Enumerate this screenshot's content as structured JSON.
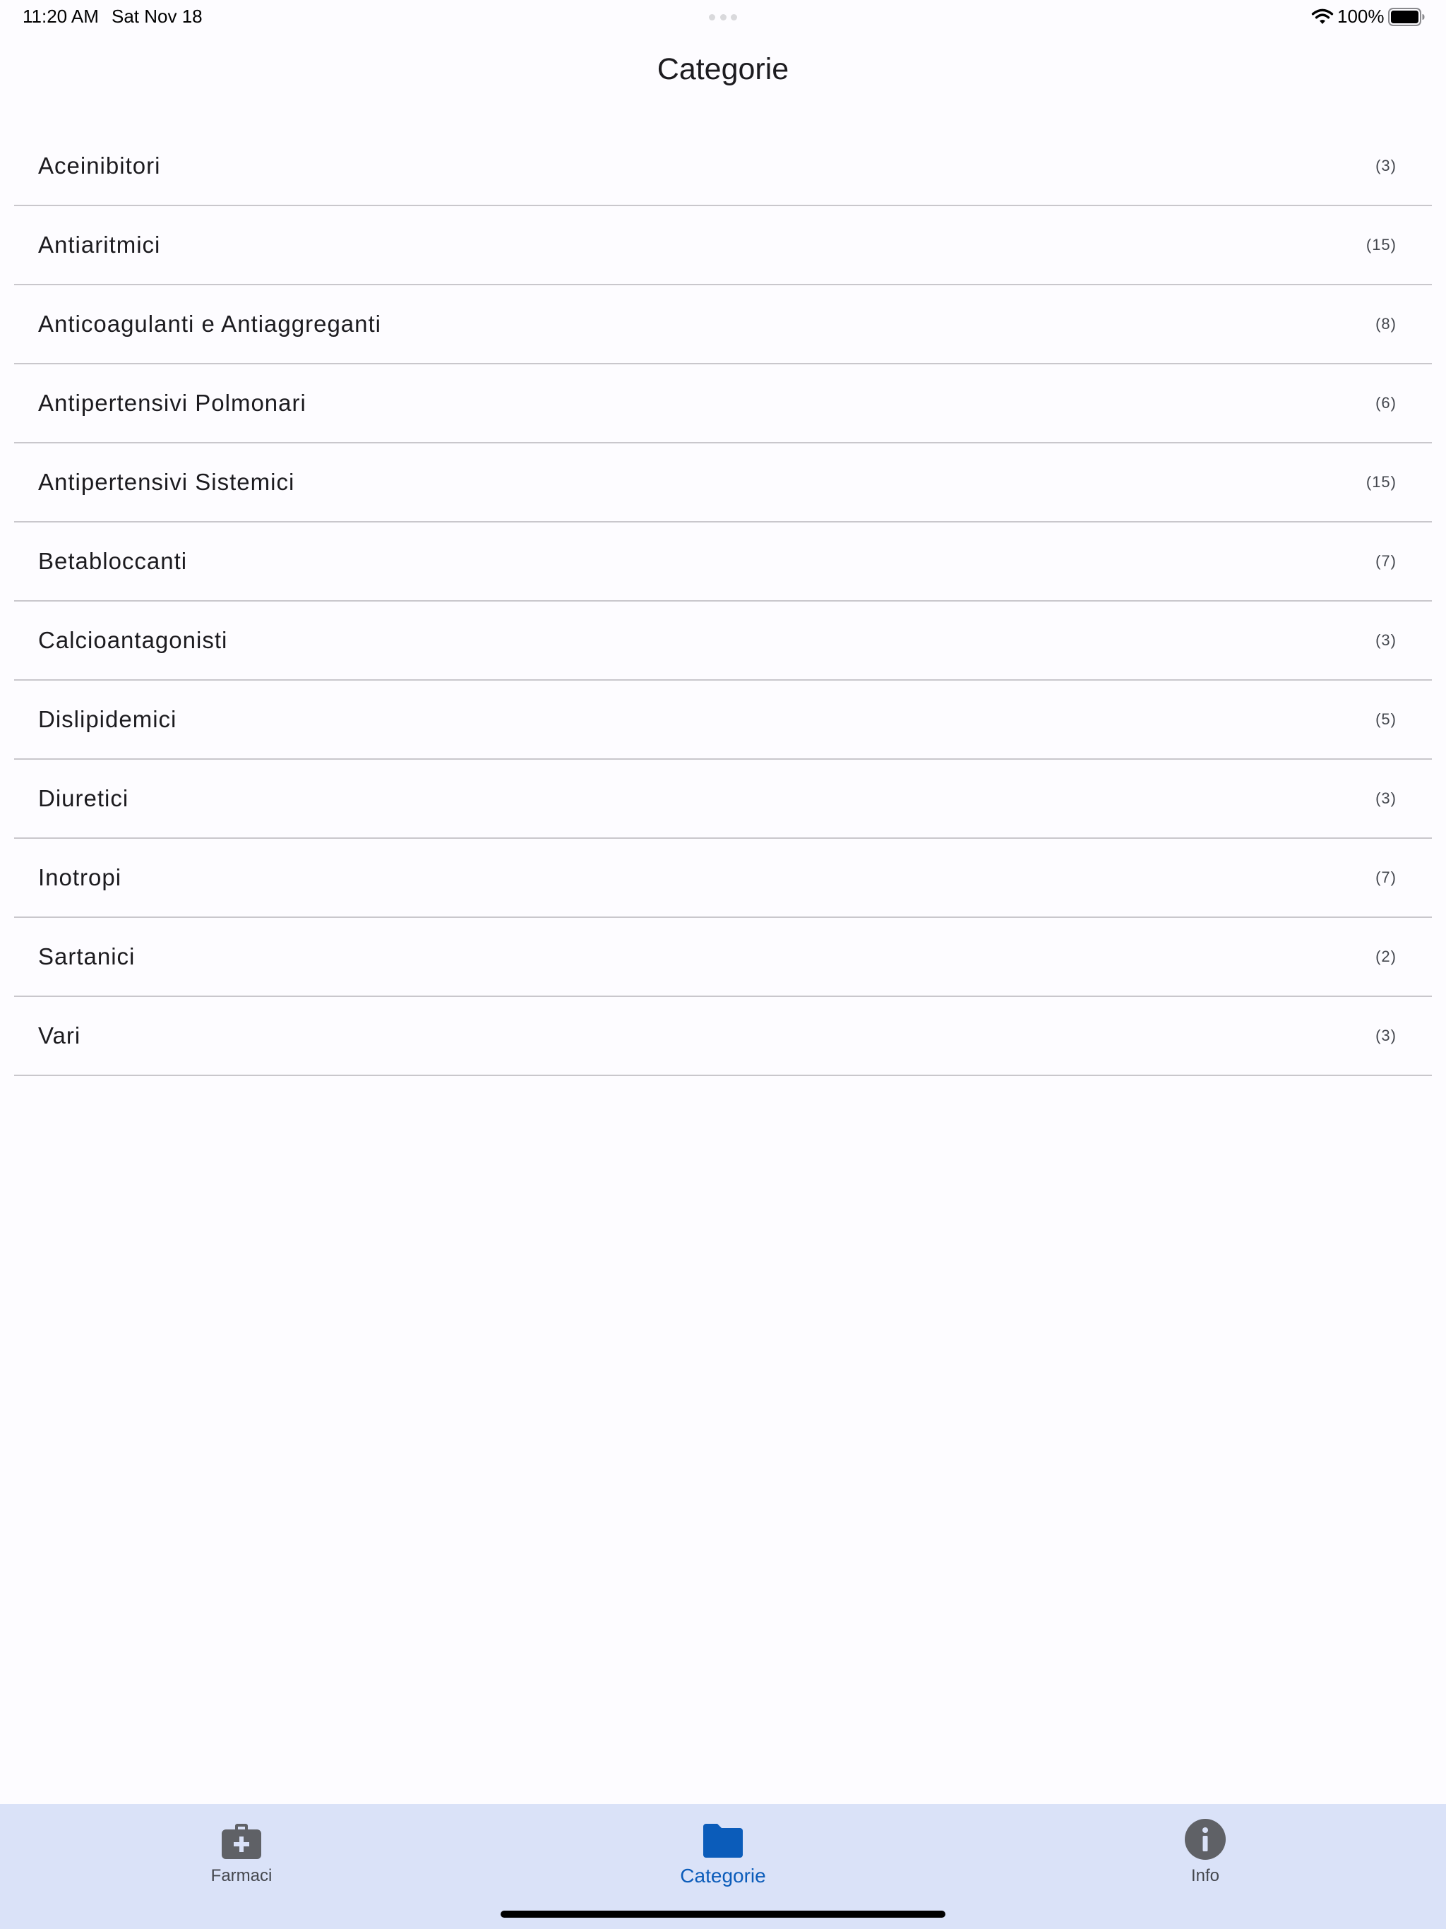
{
  "status_bar": {
    "time": "11:20 AM",
    "date": "Sat Nov 18",
    "battery_percent": "100%",
    "battery_level": 1.0
  },
  "header": {
    "title": "Categorie"
  },
  "categories": [
    {
      "name": "Aceinibitori",
      "count": "(3)"
    },
    {
      "name": "Antiaritmici",
      "count": "(15)"
    },
    {
      "name": "Anticoagulanti e Antiaggreganti",
      "count": "(8)"
    },
    {
      "name": "Antipertensivi Polmonari",
      "count": "(6)"
    },
    {
      "name": "Antipertensivi Sistemici",
      "count": "(15)"
    },
    {
      "name": "Betabloccanti",
      "count": "(7)"
    },
    {
      "name": "Calcioantagonisti",
      "count": "(3)"
    },
    {
      "name": "Dislipidemici",
      "count": "(5)"
    },
    {
      "name": "Diuretici",
      "count": "(3)"
    },
    {
      "name": "Inotropi",
      "count": "(7)"
    },
    {
      "name": "Sartanici",
      "count": "(2)"
    },
    {
      "name": "Vari",
      "count": "(3)"
    }
  ],
  "nav": {
    "items": [
      {
        "label": "Farmaci",
        "icon": "medical-bag-icon",
        "active": false
      },
      {
        "label": "Categorie",
        "icon": "folder-icon",
        "active": true
      },
      {
        "label": "Info",
        "icon": "info-icon",
        "active": false
      }
    ]
  },
  "colors": {
    "background": "#fdfcff",
    "nav_background": "#dae2f8",
    "accent": "#0b5cba",
    "nav_inactive": "#5f6166",
    "divider": "#c9c7cc"
  }
}
